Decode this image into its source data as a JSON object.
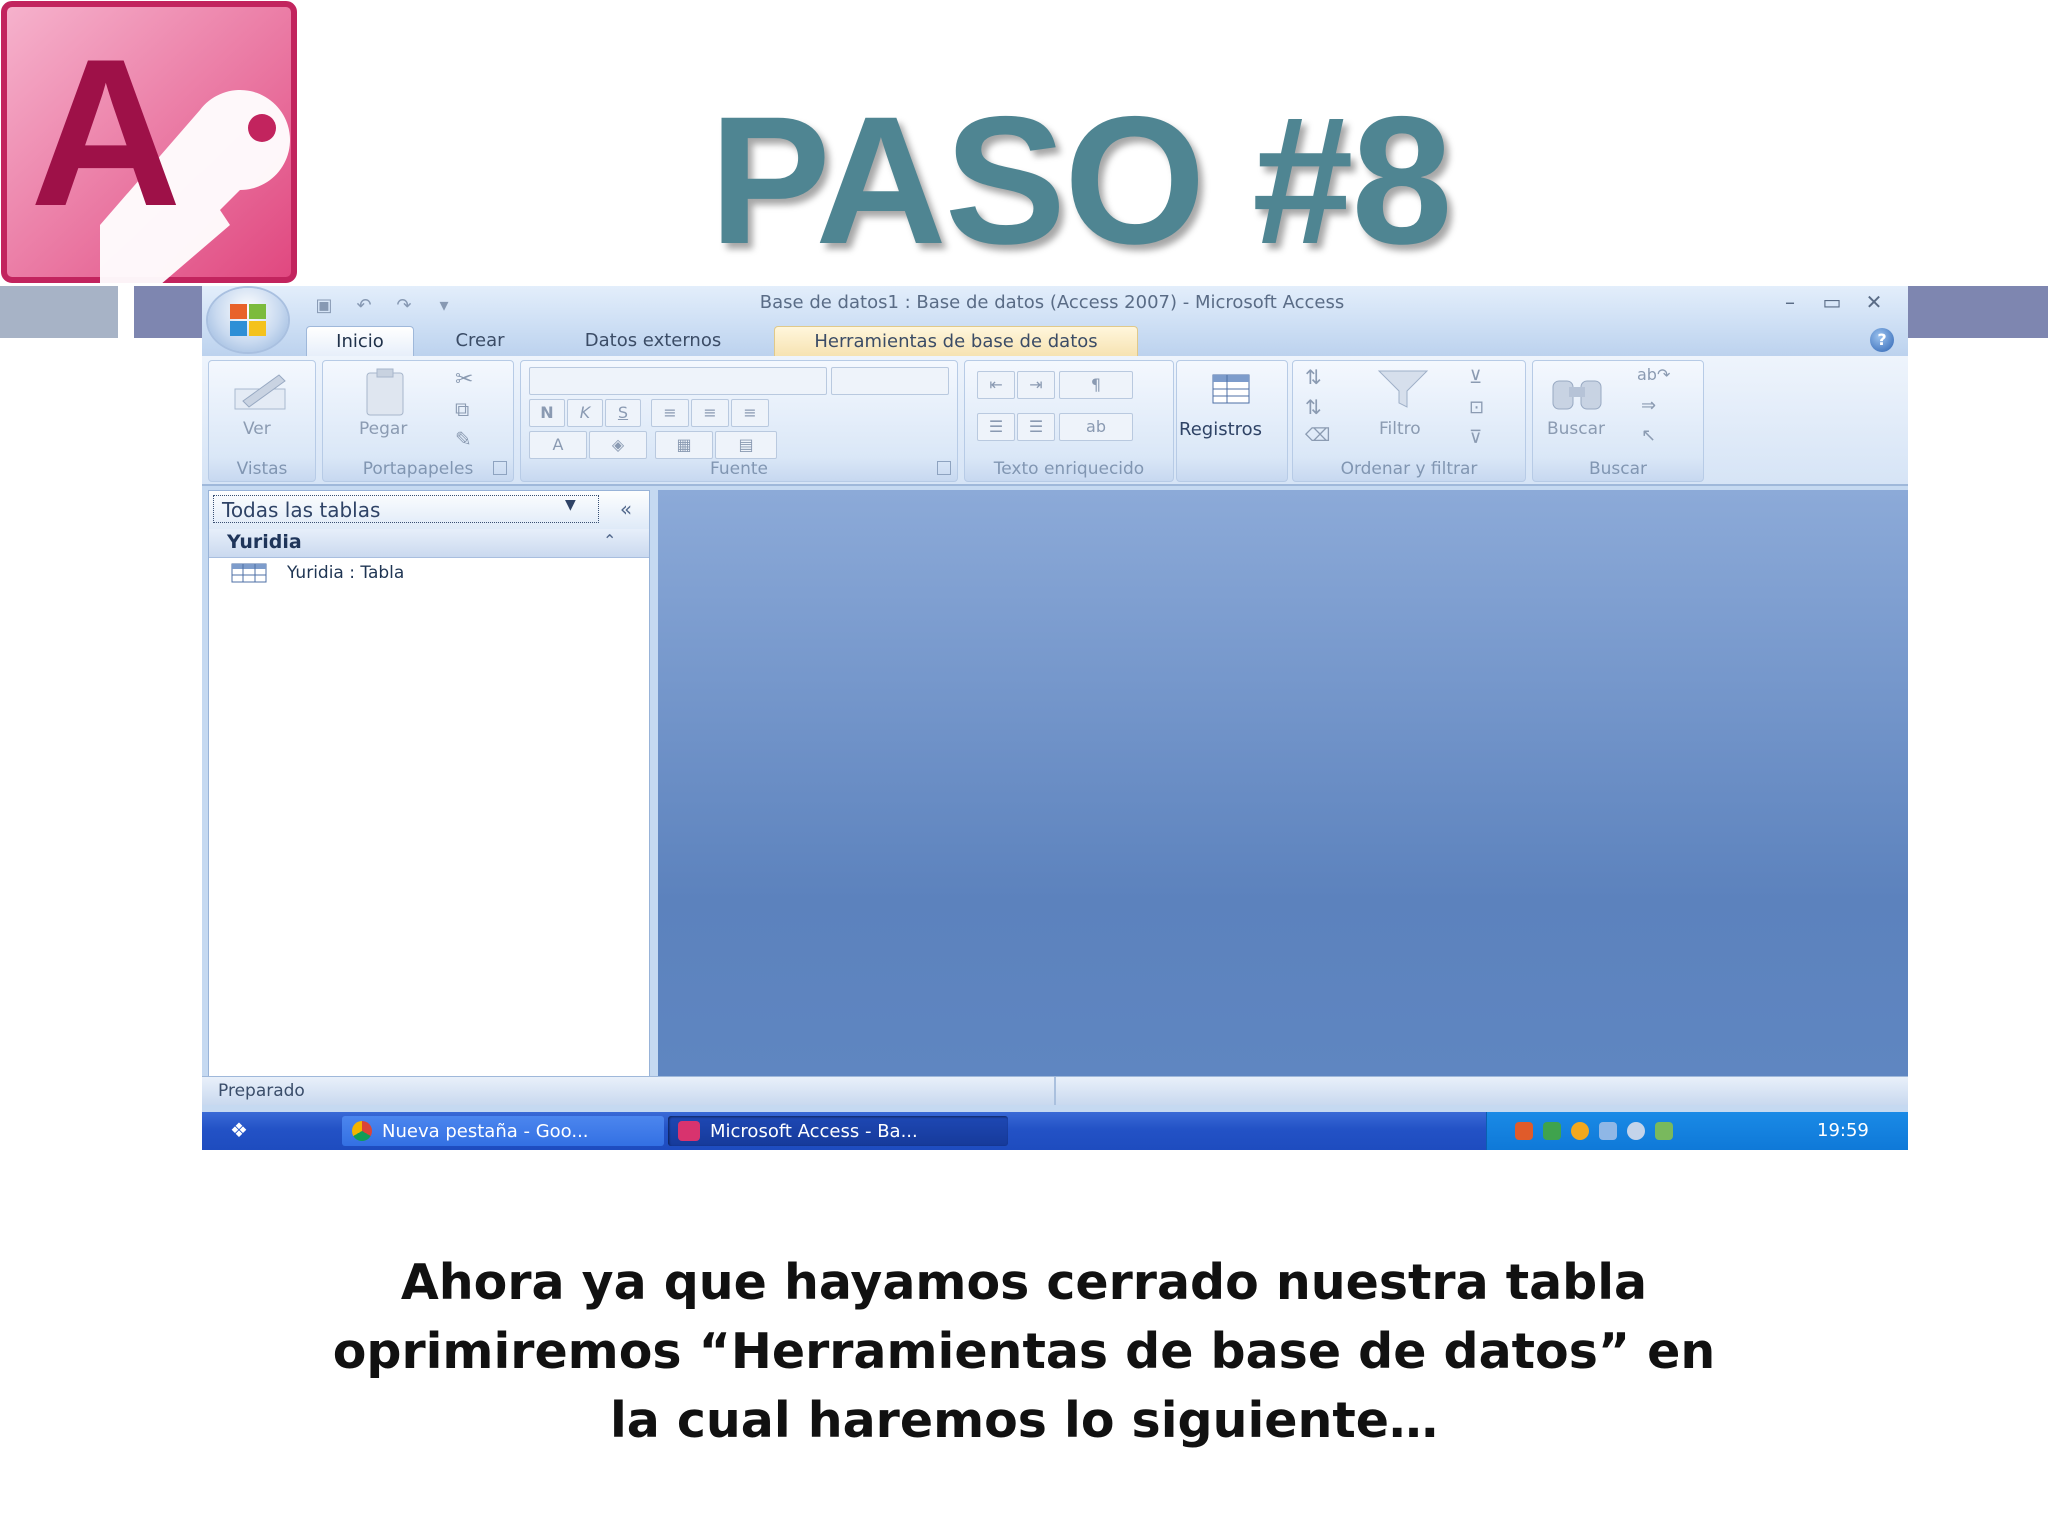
{
  "slide": {
    "title": "PASO #8",
    "caption_lines": [
      "Ahora ya que hayamos cerrado nuestra tabla",
      "oprimiremos “Herramientas de base de datos” en",
      "la cual haremos lo siguiente…"
    ],
    "logo_letter": "A"
  },
  "window": {
    "title": "Base de datos1 : Base de datos (Access 2007) - Microsoft Access",
    "controls": {
      "minimize": "–",
      "restore": "▭",
      "close": "✕"
    },
    "help": "?"
  },
  "tabs": [
    {
      "label": "Inicio",
      "active": true
    },
    {
      "label": "Crear"
    },
    {
      "label": "Datos externos"
    },
    {
      "label": "Herramientas de base de datos",
      "highlighted": true
    }
  ],
  "ribbon": {
    "groups": [
      {
        "label": "Vistas",
        "buttons": [
          "Ver"
        ]
      },
      {
        "label": "Portapapeles",
        "buttons": [
          "Pegar"
        ]
      },
      {
        "label": "Fuente",
        "buttons": [
          "N",
          "K",
          "S",
          "A"
        ]
      },
      {
        "label": "Texto enriquecido",
        "buttons": [
          "ab"
        ]
      },
      {
        "label": "",
        "buttons": [
          "Registros"
        ]
      },
      {
        "label": "Ordenar y filtrar",
        "buttons": [
          "Filtro"
        ]
      },
      {
        "label": "Buscar",
        "buttons": [
          "Buscar"
        ]
      }
    ]
  },
  "nav": {
    "selector": "Todas las tablas",
    "collapse": "«",
    "group": "Yuridia",
    "items": [
      {
        "label": "Yuridia : Tabla"
      }
    ]
  },
  "status": {
    "text": "Preparado"
  },
  "taskbar": {
    "items": [
      {
        "label": "Nueva pestaña - Goo..."
      },
      {
        "label": "Microsoft Access - Ba...",
        "active": true
      }
    ],
    "clock": "19:59"
  },
  "colors": {
    "title": "#4f8592",
    "workspace": "#6f92c9",
    "taskbar": "#2352c6",
    "access_brand": "#b31d5b"
  }
}
